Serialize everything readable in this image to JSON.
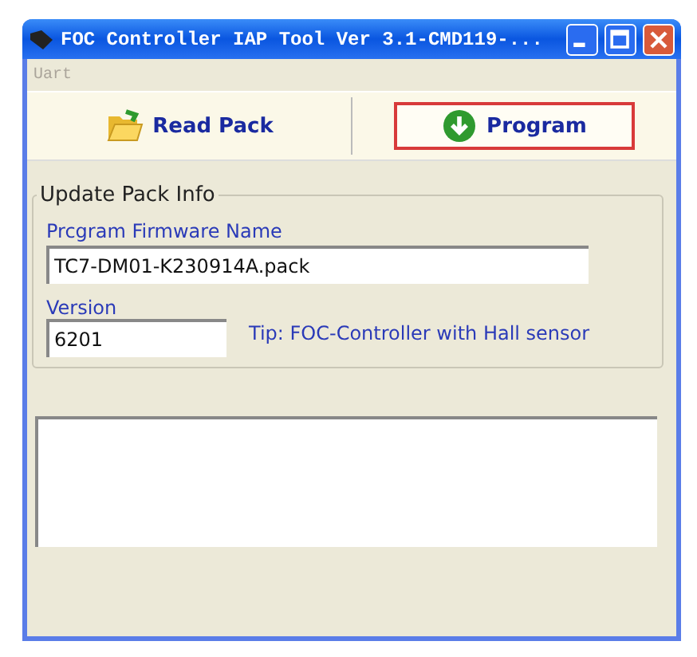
{
  "window": {
    "title": "FOC Controller IAP Tool Ver 3.1-CMD119-..."
  },
  "menu": [
    {
      "label": "Uart",
      "disabled": true
    }
  ],
  "toolbar": [
    {
      "kind": "folder",
      "label": "Read Pack",
      "selected": false
    },
    {
      "kind": "download",
      "label": "Program",
      "selected": true
    }
  ],
  "group": {
    "title": "Update Pack Info",
    "firmware_label": "Prcgram Firmware Name",
    "firmware_value": "TC7-DM01-K230914A.pack",
    "version_label": "Version",
    "version_value": "6201",
    "tip": "Tip: FOC-Controller with Hall sensor"
  }
}
